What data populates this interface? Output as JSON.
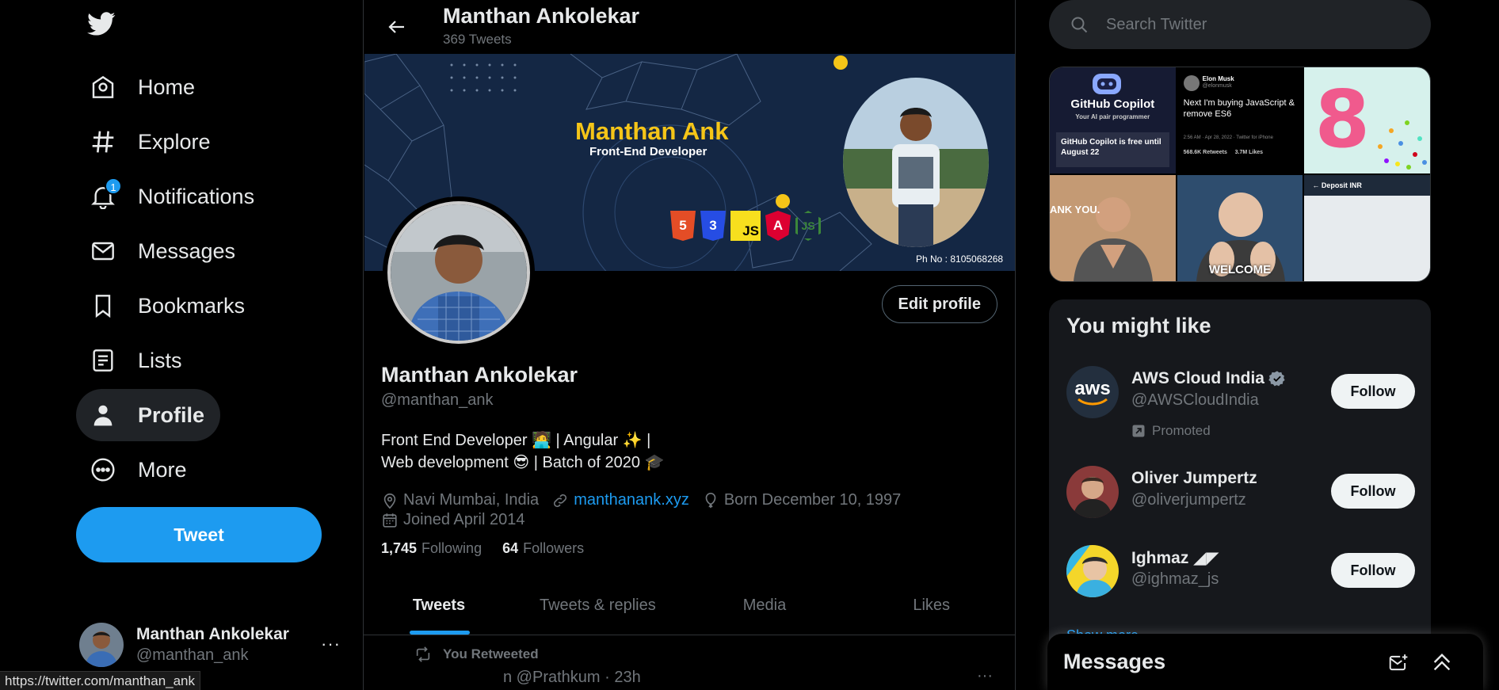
{
  "colors": {
    "accent": "#1d9bf0",
    "background": "#000000",
    "text": "#e7e9ea",
    "muted": "#71767b",
    "card": "#16181c"
  },
  "sidebar": {
    "items": [
      {
        "label": "Home",
        "icon": "home-icon"
      },
      {
        "label": "Explore",
        "icon": "hash-icon"
      },
      {
        "label": "Notifications",
        "icon": "bell-icon",
        "badge": "1"
      },
      {
        "label": "Messages",
        "icon": "envelope-icon"
      },
      {
        "label": "Bookmarks",
        "icon": "bookmark-icon"
      },
      {
        "label": "Lists",
        "icon": "list-icon"
      },
      {
        "label": "Profile",
        "icon": "person-icon",
        "active": true
      },
      {
        "label": "More",
        "icon": "more-circle-icon"
      }
    ],
    "tweet_button": "Tweet",
    "account": {
      "name": "Manthan Ankolekar",
      "handle": "@manthan_ank",
      "more": "···"
    }
  },
  "status_bar": {
    "url": "https://twitter.com/manthan_ank"
  },
  "header": {
    "name": "Manthan Ankolekar",
    "tweet_count": "369 Tweets"
  },
  "banner": {
    "title": "Manthan Ank",
    "subtitle": "Front-End Developer",
    "phone": "Ph No :  8105068268",
    "tech_logos": [
      "5",
      "3",
      "JS",
      "A",
      "JS"
    ]
  },
  "profile": {
    "name": "Manthan Ankolekar",
    "handle": "@manthan_ank",
    "edit_button": "Edit profile",
    "bio_line1": "Front End Developer 🧑‍💻 | Angular ✨ |",
    "bio_line2": "Web development 😎 | Batch of 2020 🎓",
    "location": "Navi Mumbai, India",
    "website": "manthanank.xyz",
    "birthday": "Born December 10, 1997",
    "joined": "Joined April 2014",
    "following_count": "1,745",
    "following_label": "Following",
    "followers_count": "64",
    "followers_label": "Followers"
  },
  "tabs": [
    "Tweets",
    "Tweets & replies",
    "Media",
    "Likes"
  ],
  "timeline": {
    "retweet_label": "You Retweeted",
    "peek_text": "n @Prathkum · 23h",
    "more": "···"
  },
  "search": {
    "placeholder": "Search Twitter"
  },
  "media_grid": {
    "tiles": [
      {
        "title": "GitHub Copilot",
        "sub": "Your AI pair programmer",
        "note": "GitHub Copilot is free until August 22"
      },
      {
        "author": "Elon Musk",
        "handle": "@elonmusk",
        "text": "Next I'm buying JavaScript & remove ES6",
        "meta": "2:56 AM · Apr 28, 2022 · Twitter for iPhone",
        "stats": "568.6K Retweets     3.7M Likes"
      },
      {
        "text": "8"
      },
      {
        "text": "ANK YOU."
      },
      {
        "text": "WELCOME"
      },
      {
        "text": "Deposit INR"
      }
    ]
  },
  "who_to_follow": {
    "title": "You might like",
    "follow_label": "Follow",
    "promoted_label": "Promoted",
    "show_more": "Show more",
    "users": [
      {
        "name": "AWS Cloud India",
        "handle": "@AWSCloudIndia",
        "verified": true,
        "promoted": true,
        "avatar_text": "aws"
      },
      {
        "name": "Oliver Jumpertz",
        "handle": "@oliverjumpertz"
      },
      {
        "name": "Ighmaz ◢◤",
        "handle": "@ighmaz_js"
      }
    ]
  },
  "messages_drawer": {
    "title": "Messages"
  }
}
